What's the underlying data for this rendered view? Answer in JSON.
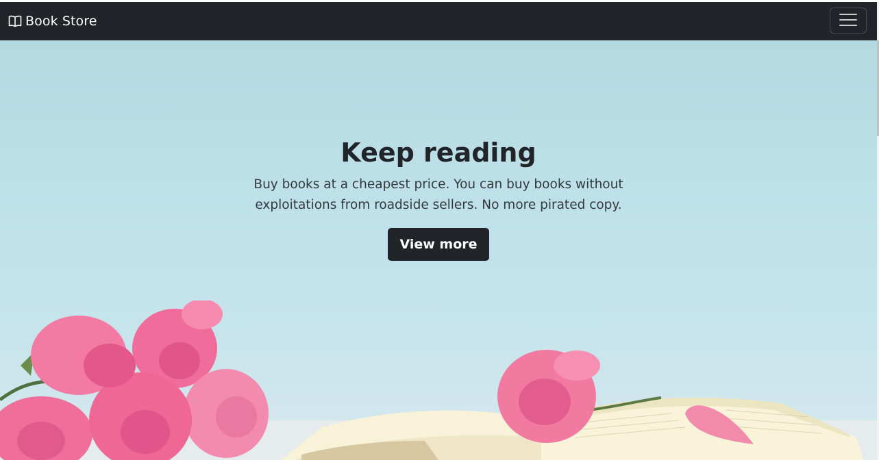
{
  "navbar": {
    "brand_icon": "book-open-icon",
    "brand_label": "Book Store",
    "toggler_icon": "hamburger-menu-icon",
    "background": "#212529"
  },
  "hero": {
    "title": "Keep reading",
    "subtitle": "Buy books at a cheapest price. You can buy books without exploitations from roadside sellers. No more pirated copy.",
    "button_label": "View more",
    "background_image": "pink roses on open book",
    "accent": "#212529"
  }
}
